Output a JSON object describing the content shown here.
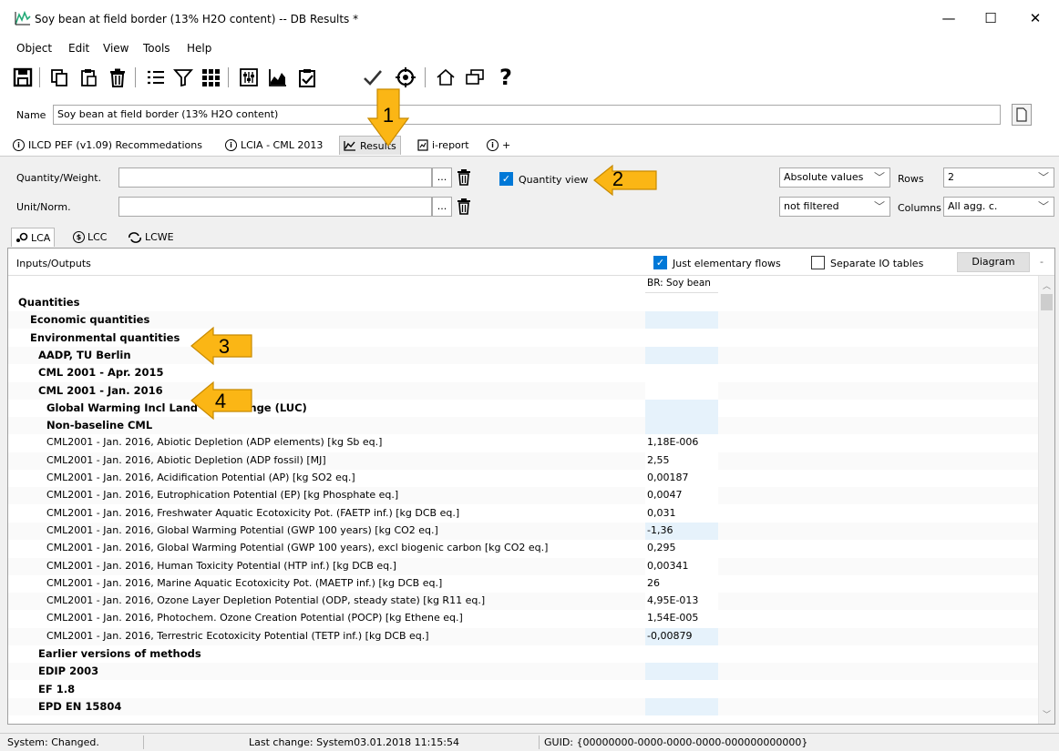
{
  "window": {
    "title": "Soy bean at field border (13% H2O content) -- DB Results *"
  },
  "menu": [
    "Object",
    "Edit",
    "View",
    "Tools",
    "Help"
  ],
  "name_field": {
    "label": "Name",
    "value": "Soy bean at field border (13% H2O content)"
  },
  "tabs": [
    {
      "label": "ILCD PEF (v1.09) Recommedations"
    },
    {
      "label": "LCIA - CML 2013"
    },
    {
      "label": "Results"
    },
    {
      "label": "i-report"
    },
    {
      "label": "+"
    }
  ],
  "filters": {
    "quantity_label": "Quantity/Weight.",
    "unit_label": "Unit/Norm.",
    "browse": "...",
    "quantity_view_label": "Quantity view",
    "absolute_values": "Absolute values",
    "not_filtered": "not filtered",
    "rows_label": "Rows",
    "rows_value": "2",
    "columns_label": "Columns",
    "columns_value": "All agg. c."
  },
  "subtabs": [
    {
      "label": "LCA"
    },
    {
      "label": "LCC"
    },
    {
      "label": "LCWE"
    }
  ],
  "panel": {
    "io_label": "Inputs/Outputs",
    "just_elementary": "Just elementary flows",
    "separate_io": "Separate IO tables",
    "diagram": "Diagram",
    "minus": "-",
    "col_header": "BR: Soy bean"
  },
  "rows": [
    {
      "label": "Quantities",
      "value": ""
    },
    {
      "label": "Economic quantities",
      "value": ""
    },
    {
      "label": "Environmental quantities",
      "value": ""
    },
    {
      "label": "AADP, TU Berlin",
      "value": ""
    },
    {
      "label": "CML 2001 - Apr. 2015",
      "value": ""
    },
    {
      "label": "CML 2001 - Jan. 2016",
      "value": ""
    },
    {
      "label": "Global Warming Incl Land Use Change (LUC)",
      "value": ""
    },
    {
      "label": "Non-baseline CML",
      "value": ""
    },
    {
      "label": "CML2001 - Jan. 2016, Abiotic Depletion (ADP elements) [kg Sb eq.]",
      "value": "1,18E-006"
    },
    {
      "label": "CML2001 - Jan. 2016, Abiotic Depletion (ADP fossil) [MJ]",
      "value": "2,55"
    },
    {
      "label": "CML2001 - Jan. 2016, Acidification Potential (AP) [kg SO2 eq.]",
      "value": "0,00187"
    },
    {
      "label": "CML2001 - Jan. 2016, Eutrophication Potential (EP) [kg Phosphate eq.]",
      "value": "0,0047"
    },
    {
      "label": "CML2001 - Jan. 2016, Freshwater Aquatic Ecotoxicity Pot. (FAETP inf.) [kg DCB eq.]",
      "value": "0,031"
    },
    {
      "label": "CML2001 - Jan. 2016, Global Warming Potential (GWP 100 years) [kg CO2 eq.]",
      "value": "-1,36"
    },
    {
      "label": "CML2001 - Jan. 2016, Global Warming Potential (GWP 100 years), excl biogenic carbon [kg CO2 eq.]",
      "value": "0,295"
    },
    {
      "label": "CML2001 - Jan. 2016, Human Toxicity Potential (HTP inf.) [kg DCB eq.]",
      "value": "0,00341"
    },
    {
      "label": "CML2001 - Jan. 2016, Marine Aquatic Ecotoxicity Pot. (MAETP inf.) [kg DCB eq.]",
      "value": "26"
    },
    {
      "label": "CML2001 - Jan. 2016, Ozone Layer Depletion Potential (ODP, steady state) [kg R11 eq.]",
      "value": "4,95E-013"
    },
    {
      "label": "CML2001 - Jan. 2016, Photochem. Ozone Creation Potential (POCP) [kg Ethene eq.]",
      "value": "1,54E-005"
    },
    {
      "label": "CML2001 - Jan. 2016, Terrestric Ecotoxicity Potential (TETP inf.) [kg DCB eq.]",
      "value": "-0,00879"
    },
    {
      "label": "Earlier versions of methods",
      "value": ""
    },
    {
      "label": "EDIP 2003",
      "value": ""
    },
    {
      "label": "EF 1.8",
      "value": ""
    },
    {
      "label": "EPD EN 15804",
      "value": ""
    }
  ],
  "callouts": [
    "1",
    "2",
    "3",
    "4"
  ],
  "status": {
    "left": "System: Changed.",
    "mid": "Last change: System03.01.2018 11:15:54",
    "right": "GUID: {00000000-0000-0000-0000-000000000000}"
  },
  "colors": {
    "accent": "#0078d7",
    "callout": "#fbb615",
    "value_bg": "#e6f2fb"
  }
}
